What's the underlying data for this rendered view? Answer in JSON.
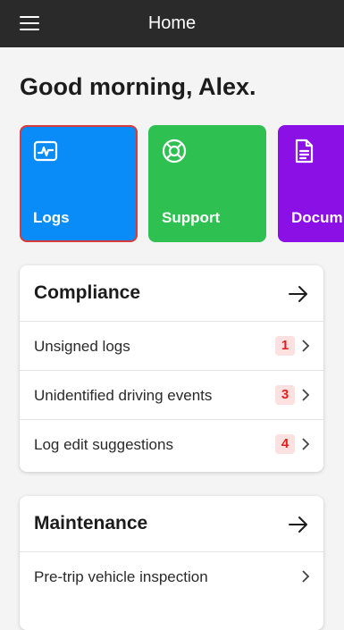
{
  "topbar": {
    "title": "Home",
    "menu_icon": "hamburger-icon"
  },
  "greeting": "Good morning, Alex.",
  "tiles": [
    {
      "label": "Logs",
      "icon": "activity-icon",
      "color": "#0a8cf8",
      "selected": true
    },
    {
      "label": "Support",
      "icon": "lifebuoy-icon",
      "color": "#2fc052"
    },
    {
      "label": "Docum",
      "icon": "document-icon",
      "color": "#8a10e6"
    }
  ],
  "compliance": {
    "title": "Compliance",
    "rows": [
      {
        "label": "Unsigned logs",
        "badge": "1"
      },
      {
        "label": "Unidentified driving events",
        "badge": "3"
      },
      {
        "label": "Log edit suggestions",
        "badge": "4"
      }
    ]
  },
  "maintenance": {
    "title": "Maintenance",
    "rows": [
      {
        "label": "Pre-trip vehicle inspection"
      }
    ]
  },
  "colors": {
    "badge_bg": "#fde0e0",
    "badge_text": "#e02020",
    "topbar": "#2a2a2a"
  }
}
